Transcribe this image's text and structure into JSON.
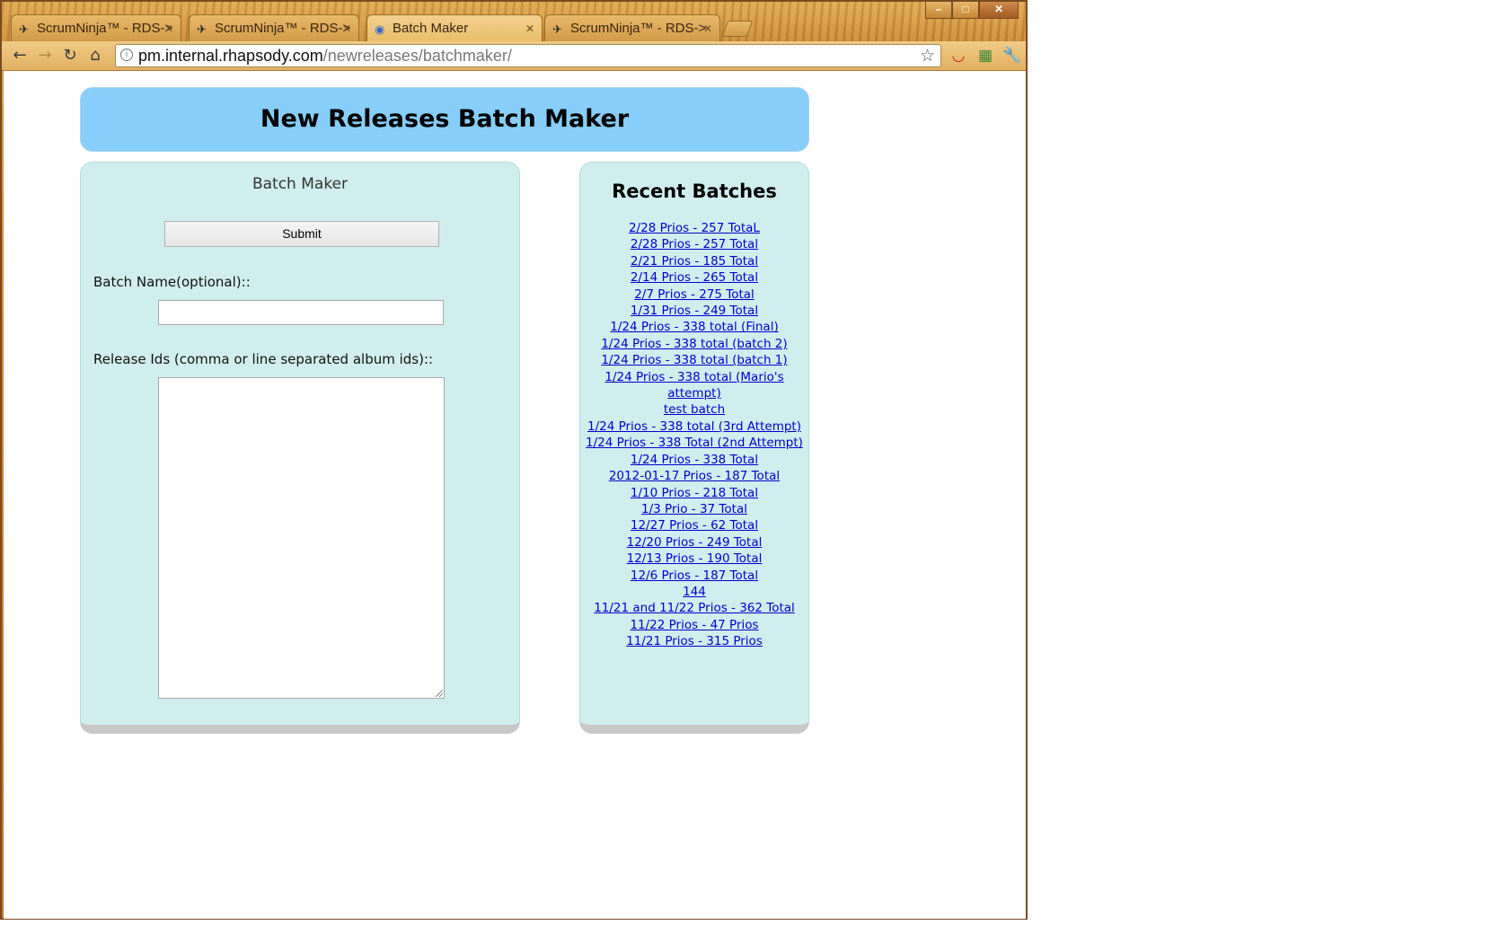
{
  "browser": {
    "tabs": [
      {
        "label": "ScrumNinja™ - RDS->",
        "icon": "ninja-icon",
        "active": false
      },
      {
        "label": "ScrumNinja™ - RDS->",
        "icon": "ninja-icon",
        "active": false
      },
      {
        "label": "Batch Maker",
        "icon": "page-icon",
        "active": true
      },
      {
        "label": "ScrumNinja™ - RDS->",
        "icon": "ninja-icon",
        "active": false
      }
    ],
    "url_host": "pm.internal.rhapsody.com",
    "url_path": "/newreleases/batchmaker/",
    "window_buttons": {
      "minimize": "–",
      "maximize": "□",
      "close": "✕"
    }
  },
  "page": {
    "header_title": "New Releases Batch Maker",
    "form": {
      "title": "Batch Maker",
      "submit_label": "Submit",
      "batch_name_label": "Batch Name(optional)::",
      "batch_name_value": "",
      "release_ids_label": "Release Ids (comma or line separated album ids)::",
      "release_ids_value": ""
    },
    "recent": {
      "title": "Recent Batches",
      "batches": [
        "2/28 Prios - 257 TotaL",
        "2/28 Prios - 257 Total",
        "2/21 Prios - 185 Total",
        "2/14 Prios - 265 Total",
        "2/7 Prios - 275 Total",
        "1/31 Prios - 249 Total",
        "1/24 Prios - 338 total (Final)",
        "1/24 Prios - 338 total (batch 2)",
        "1/24 Prios - 338 total (batch 1)",
        "1/24 Prios - 338 total (Mario's attempt)",
        "test batch",
        "1/24 Prios - 338 total (3rd Attempt)",
        "1/24 Prios - 338 Total (2nd Attempt)",
        "1/24 Prios - 338 Total",
        "2012-01-17 Prios - 187 Total",
        "1/10 Prios - 218 Total",
        "1/3 Prio - 37 Total",
        "12/27 Prios - 62 Total",
        "12/20 Prios - 249 Total",
        "12/13 Prios - 190 Total",
        "12/6 Prios - 187 Total",
        "144",
        "11/21 and 11/22 Prios - 362 Total",
        "11/22 Prios - 47 Prios",
        "11/21 Prios - 315 Prios"
      ]
    }
  },
  "colors": {
    "header_bg": "#87cefa",
    "panel_bg": "#d0eeee",
    "link": "#0000cc"
  }
}
